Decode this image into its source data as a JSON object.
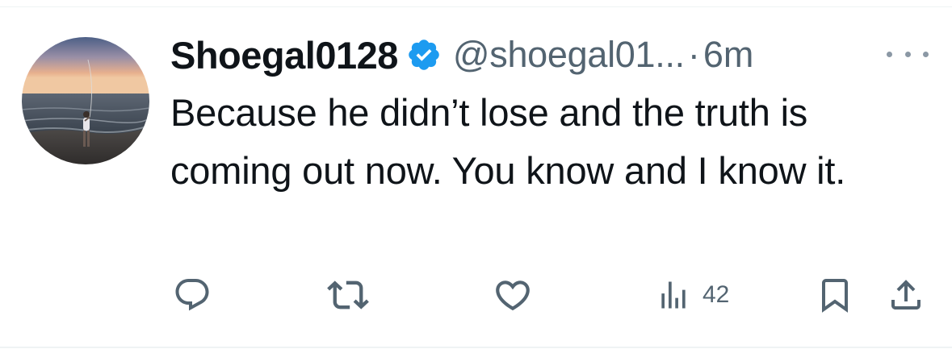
{
  "tweet": {
    "display_name": "Shoegal0128",
    "handle": "@shoegal01...",
    "separator": "·",
    "time": "6m",
    "verified": true,
    "text": "Because he didn’t lose and the truth is coming out now. You know and I know it.",
    "icons": {
      "verified": "verified-badge-icon",
      "more": "more-icon",
      "reply": "reply-icon",
      "retweet": "retweet-icon",
      "like": "like-icon",
      "views": "views-icon",
      "bookmark": "bookmark-icon",
      "share": "share-icon"
    },
    "stats": {
      "views": "42"
    }
  },
  "colors": {
    "text": "#0f1419",
    "secondary": "#536471",
    "verified_blue": "#1d9bf0",
    "divider": "#eff3f4"
  }
}
